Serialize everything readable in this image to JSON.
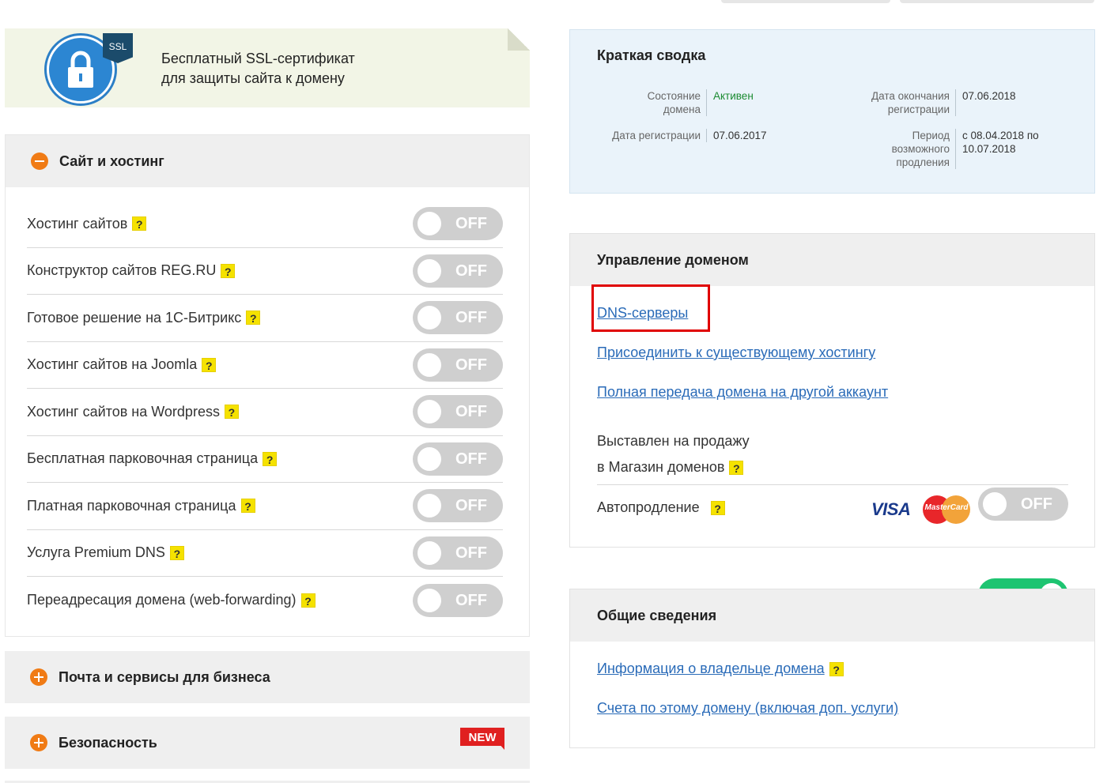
{
  "ssl_banner": {
    "badge": "SSL",
    "line1": "Бесплатный SSL-сертификат",
    "line2": "для защиты сайта к домену",
    "icon": "lock-icon"
  },
  "hosting_section": {
    "title": "Сайт и хостинг",
    "items": [
      {
        "label": "Хостинг сайтов",
        "state": "OFF"
      },
      {
        "label": "Конструктор сайтов REG.RU",
        "state": "OFF"
      },
      {
        "label": "Готовое решение на 1С-Битрикс",
        "state": "OFF"
      },
      {
        "label": "Хостинг сайтов на Joomla",
        "state": "OFF"
      },
      {
        "label": "Хостинг сайтов на Wordpress",
        "state": "OFF"
      },
      {
        "label": "Бесплатная парковочная страница",
        "state": "OFF"
      },
      {
        "label": "Платная парковочная страница",
        "state": "OFF"
      },
      {
        "label": "Услуга Premium DNS",
        "state": "OFF"
      },
      {
        "label": "Переадресация домена (web-forwarding)",
        "state": "OFF"
      }
    ],
    "help_mark": "?"
  },
  "mail_section": {
    "title": "Почта и сервисы для бизнеса"
  },
  "security_section": {
    "title": "Безопасность",
    "badge": "NEW"
  },
  "summary": {
    "title": "Краткая сводка",
    "domain_state_label": "Состояние домена",
    "domain_state_value": "Активен",
    "reg_end_label": "Дата окончания регистрации",
    "reg_end_value": "07.06.2018",
    "reg_date_label": "Дата регистрации",
    "reg_date_value": "07.06.2017",
    "renew_period_label": "Период возможного продления",
    "renew_period_value": "с 08.04.2018 по 10.07.2018"
  },
  "domain_mgmt": {
    "title": "Управление доменом",
    "links": [
      "DNS-серверы",
      "Присоединить к существующему хостингу",
      "Полная передача домена на другой аккаунт"
    ],
    "for_sale_line1": "Выставлен на продажу",
    "for_sale_line2": "в Магазин доменов",
    "for_sale_state": "OFF",
    "autorenew_label": "Автопродление",
    "autorenew_state": "ON",
    "visa": "VISA",
    "mastercard": "MasterCard"
  },
  "general_info": {
    "title": "Общие сведения",
    "owner_link": "Информация о владельце домена",
    "bills_link": "Счета по этому домену (включая доп. услуги)"
  },
  "colors": {
    "accent_orange": "#f07b15",
    "link_blue": "#2a6bb8",
    "toggle_on": "#1ec471",
    "toggle_off": "#cfcfcf",
    "highlight_red": "#e00000"
  }
}
